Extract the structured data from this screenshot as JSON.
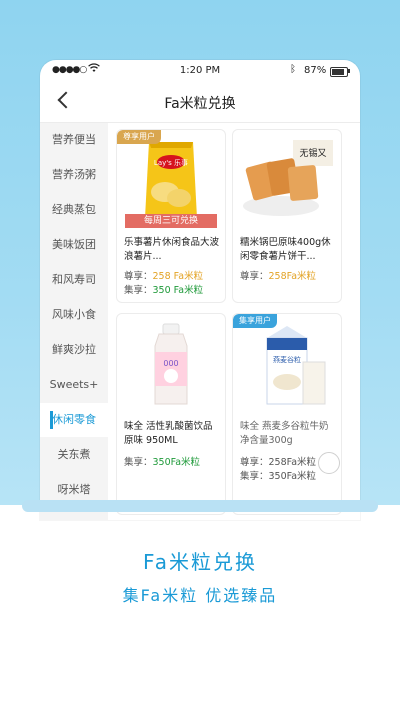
{
  "status_bar": {
    "signal": "●●●●○",
    "time": "1:20 PM",
    "battery": "87%"
  },
  "nav": {
    "title": "Fa米粒兑换"
  },
  "sidebar": {
    "items": [
      {
        "label": "营养便当"
      },
      {
        "label": "营养汤粥"
      },
      {
        "label": "经典蒸包"
      },
      {
        "label": "美味饭团"
      },
      {
        "label": "和风寿司"
      },
      {
        "label": "风味小食"
      },
      {
        "label": "鲜爽沙拉"
      },
      {
        "label": "Sweets+"
      },
      {
        "label": "休闲零食"
      },
      {
        "label": "关东煮"
      },
      {
        "label": "呀米塔"
      }
    ],
    "active_index": 8
  },
  "products": [
    {
      "tag": "尊享用户",
      "ribbon": "每周三可兑换",
      "name": "乐事薯片休闲食品大波浪薯片...",
      "price1_label": "尊享：",
      "price1_value": "258 Fa米粒",
      "price2_label": "集享：",
      "price2_value": "350 Fa米粒",
      "img_brand": "Lay's 乐事"
    },
    {
      "name": "糯米锅巴原味400g休闲零食薯片饼干...",
      "price1_label": "尊享：",
      "price1_value": "258Fa米粒",
      "img_brand": "无锡又"
    },
    {
      "name": "味全 活性乳酸菌饮品原味 950ML",
      "price1_label": "集享：",
      "price1_value": "350Fa米粒",
      "img_brand": "000"
    },
    {
      "tag": "集享用户",
      "name": "味全 燕麦多谷粒牛奶净含量300g",
      "price1_label": "尊享：",
      "price1_value": "258Fa米粒",
      "price2_label": "集享：",
      "price2_value": "350Fa米粒",
      "img_brand": "燕麦谷粒"
    }
  ],
  "promo": {
    "title": "Fa米粒兑换",
    "subtitle": "集Fa米粒 优选臻品"
  },
  "colors": {
    "accent": "#1a9ad6",
    "gold": "#e3a325",
    "green": "#1f9a3a",
    "ribbon": "#e36c63"
  }
}
